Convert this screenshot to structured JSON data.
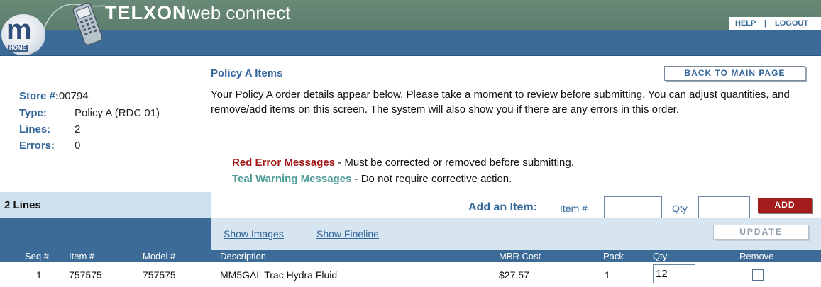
{
  "header": {
    "logo_letter": "m",
    "home_label": "HOME",
    "brand_bold": "TELXON",
    "brand_light": "web connect",
    "help_label": "HELP",
    "separator": "|",
    "logout_label": "LOGOUT"
  },
  "store_info": {
    "store_label": "Store #:",
    "store_value": "00794",
    "type_label": "Type:",
    "type_value": "Policy A (RDC 01)",
    "lines_label": "Lines:",
    "lines_value": "2",
    "errors_label": "Errors:",
    "errors_value": "0"
  },
  "page": {
    "title": "Policy A Items",
    "back_button": "BACK TO MAIN PAGE",
    "intro": "Your Policy A order details appear below. Please take a moment to review before submitting. You can adjust quantities, and remove/add items on this screen. The system will also show you if there are any errors in this order.",
    "red_key": "Red Error Messages",
    "red_text": " - Must be corrected or removed before submitting.",
    "teal_key": "Teal Warning Messages",
    "teal_text": " - Do not require corrective action."
  },
  "lines_bar": {
    "count_label": "2 Lines",
    "add_item_label": "Add an Item:",
    "item_label": "Item #",
    "item_value": "",
    "qty_label": "Qty",
    "qty_value": "",
    "add_button": "ADD"
  },
  "table": {
    "show_images": "Show Images",
    "show_fineline": "Show Fineline",
    "update_button": "UPDATE",
    "columns": [
      "Seq #",
      "Item #",
      "Model #",
      "Description",
      "MBR Cost",
      "Pack",
      "Qty",
      "Remove"
    ],
    "rows": [
      {
        "seq": "1",
        "item": "757575",
        "model": "757575",
        "description": "MM5GAL Trac Hydra Fluid",
        "mbr_cost": "$27.57",
        "pack": "1",
        "qty": "12",
        "remove": false
      }
    ]
  },
  "colors": {
    "header_green": "#5d7e6c",
    "header_blue": "#3d6b97",
    "label_blue": "#33669a",
    "error_red": "#a01818",
    "warning_teal": "#4a9a96",
    "add_button_red": "#a41c1c"
  }
}
